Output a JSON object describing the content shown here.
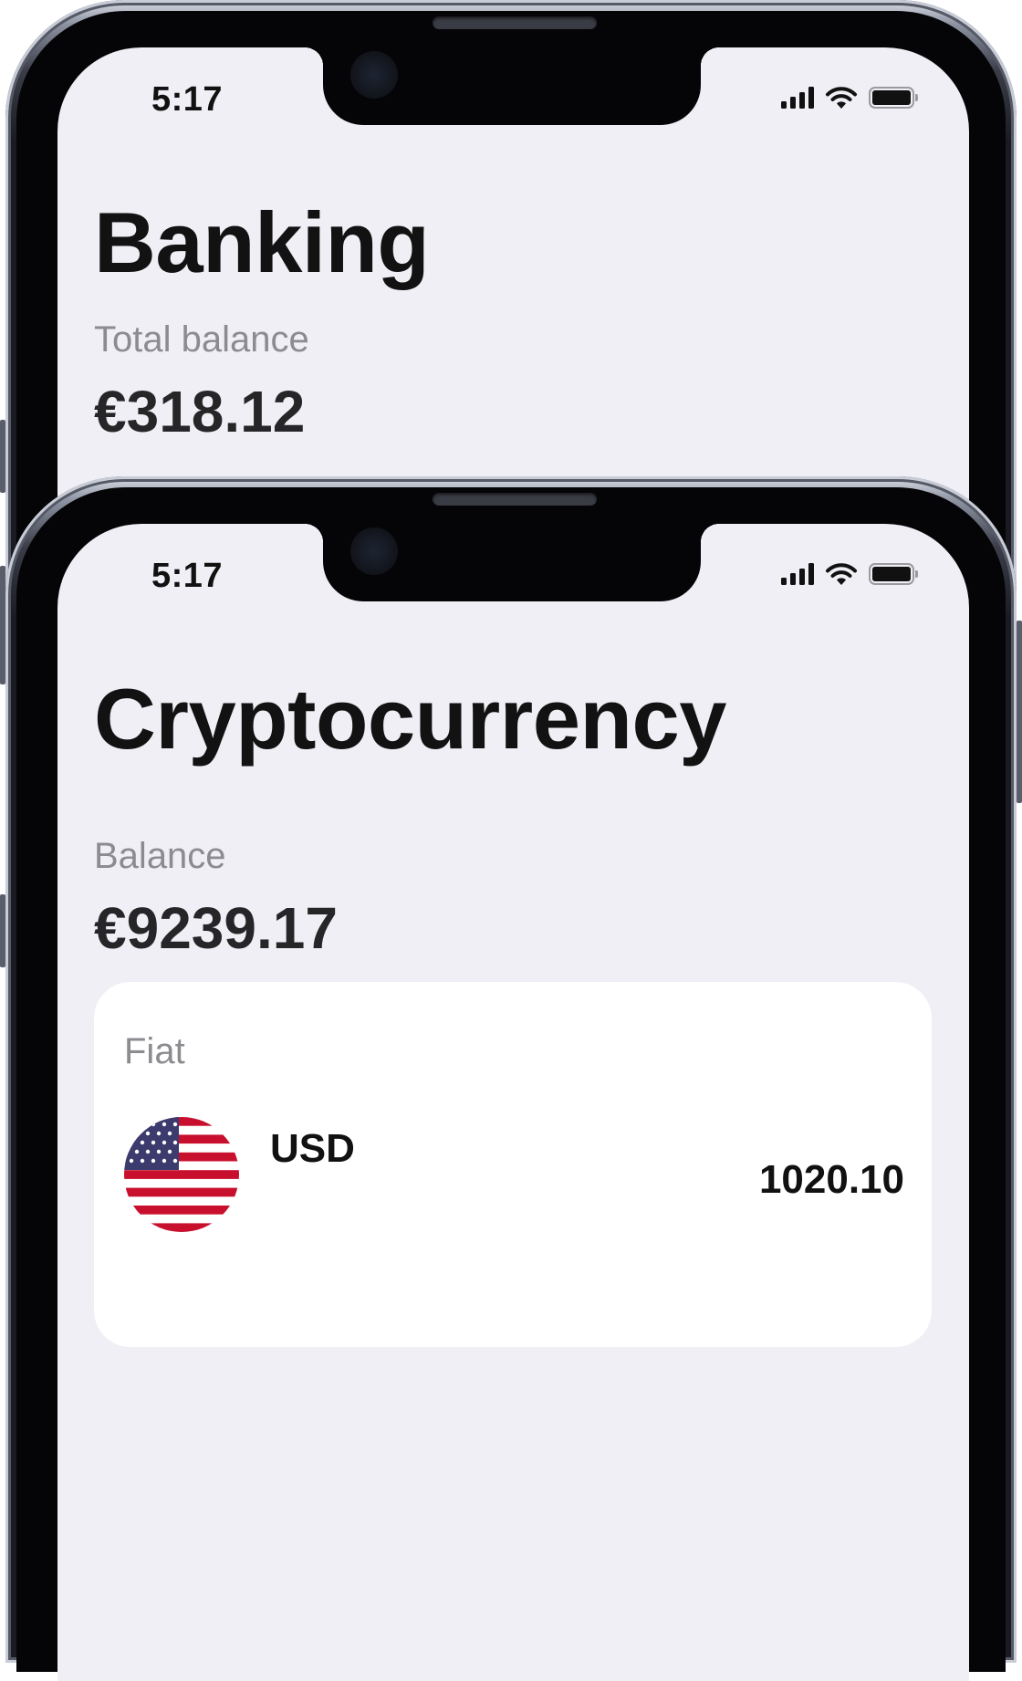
{
  "back_phone": {
    "status_time": "5:17",
    "title": "Banking",
    "balance_label": "Total balance",
    "balance_value": "€318.12"
  },
  "front_phone": {
    "status_time": "5:17",
    "title": "Cryptocurrency",
    "balance_label": "Balance",
    "balance_value": "€9239.17",
    "card": {
      "title": "Fiat",
      "rows": [
        {
          "code": "USD",
          "amount": "1020.10",
          "flag": "us-flag-icon"
        }
      ]
    }
  },
  "status_icons": [
    "cellular-signal-icon",
    "wifi-icon",
    "battery-icon"
  ],
  "colors": {
    "screen_background": "#f0eff5",
    "card_background": "#ffffff",
    "label_gray": "#8b8b90",
    "text_dark": "#121212"
  }
}
